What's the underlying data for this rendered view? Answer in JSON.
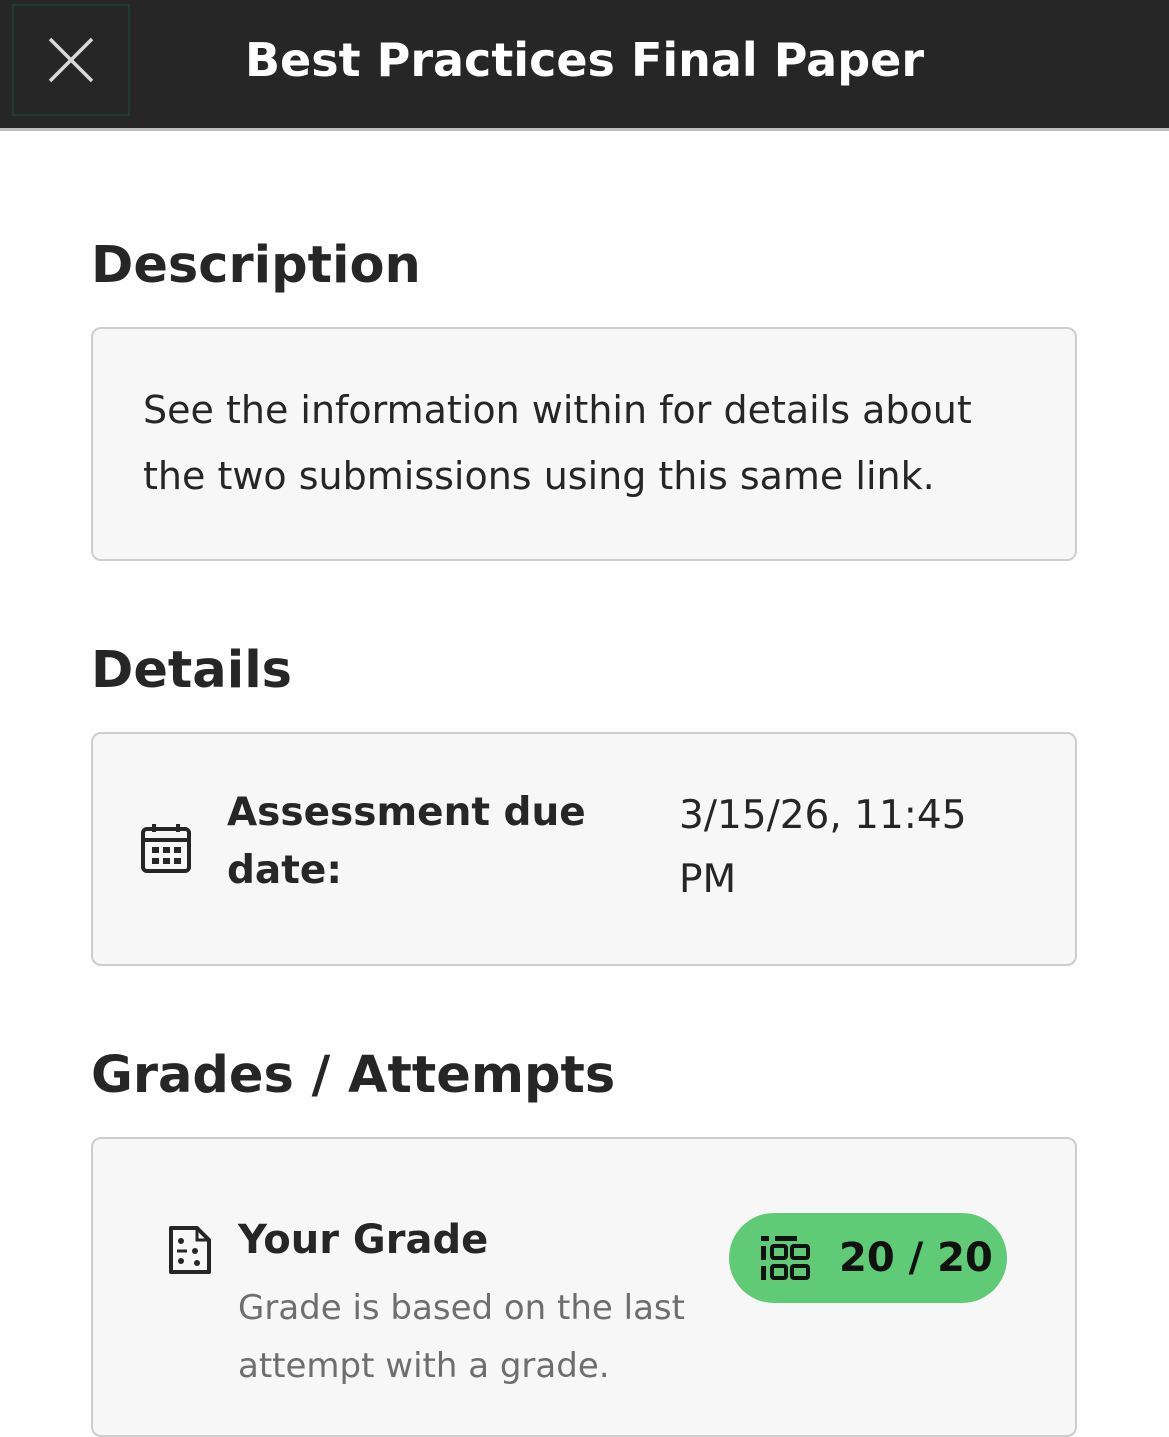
{
  "header": {
    "title": "Best Practices Final Paper",
    "close_icon": "close-icon"
  },
  "description": {
    "heading": "Description",
    "text": "See the information within for details about the two submissions using this same link."
  },
  "details": {
    "heading": "Details",
    "due_label": "Assessment due date:",
    "due_value": "3/15/26, 11:45 PM",
    "icon": "calendar-icon"
  },
  "grades": {
    "heading": "Grades / Attempts",
    "your_grade_label": "Your Grade",
    "your_grade_note": "Grade is based on the last attempt with a grade.",
    "score": "20 / 20",
    "score_color": "#5fcb76",
    "grade_icon": "grade-document-icon",
    "pill_icon": "gradebook-icon"
  }
}
